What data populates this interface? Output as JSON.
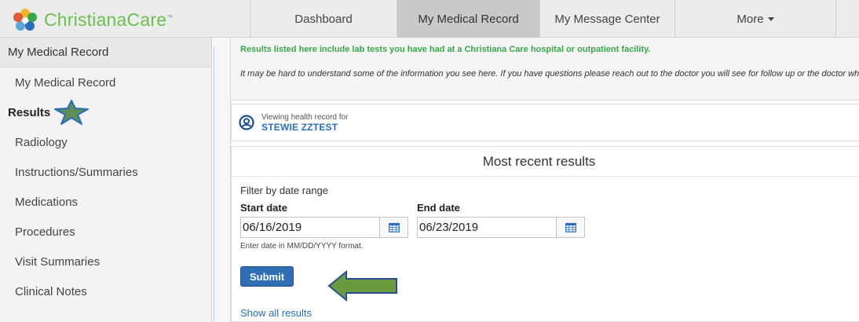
{
  "brand": {
    "name_prefix": "Christiana",
    "name_suffix": "Care",
    "trademark": "™",
    "logo_icon": "flower-logo-icon"
  },
  "nav": {
    "dashboard": "Dashboard",
    "medical_record": "My Medical Record",
    "message_center": "My Message Center",
    "more": "More"
  },
  "sidebar": {
    "header": "My Medical Record",
    "items": [
      {
        "label": "My Medical Record"
      },
      {
        "label": "Results"
      },
      {
        "label": "Radiology"
      },
      {
        "label": "Instructions/Summaries"
      },
      {
        "label": "Medications"
      },
      {
        "label": "Procedures"
      },
      {
        "label": "Visit Summaries"
      },
      {
        "label": "Clinical Notes"
      }
    ]
  },
  "notice": {
    "green": "Results listed here include lab tests you have had at a Christiana Care hospital or outpatient facility.",
    "italic": "It may be hard to understand some of the information you see here. If you have questions please reach out to the doctor you will see for follow up or the doctor who ordered the test for help."
  },
  "patient": {
    "viewing_label": "Viewing health record for",
    "name": "STEWIE ZZTEST",
    "icon": "user-circle-icon"
  },
  "results": {
    "title": "Most recent results",
    "filter_label": "Filter by date range",
    "start_label": "Start date",
    "end_label": "End date",
    "start_value": "06/16/2019",
    "end_value": "06/23/2019",
    "hint": "Enter date in MM/DD/YYYY format.",
    "submit": "Submit",
    "show_all": "Show all results"
  },
  "colors": {
    "brand_green": "#6cbf4e",
    "link_blue": "#2a6ebb",
    "button_blue": "#2f6db5",
    "annotation_green": "#6a9a3e",
    "annotation_star": "#5e8f5a"
  }
}
